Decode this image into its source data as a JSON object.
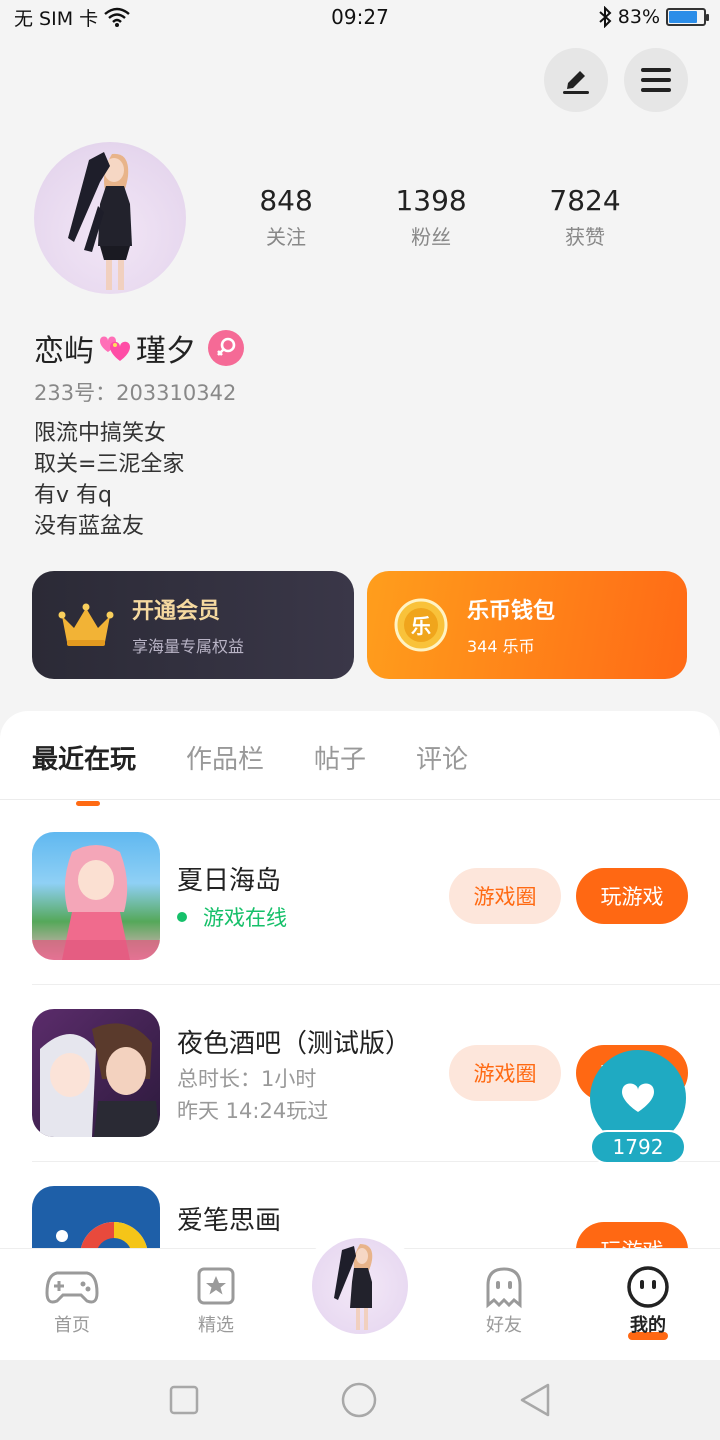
{
  "status_bar": {
    "carrier": "无 SIM 卡",
    "time": "09:27",
    "battery_percent": "83%",
    "battery_level": 0.83
  },
  "profile": {
    "stats": [
      {
        "value": "848",
        "label": "关注"
      },
      {
        "value": "1398",
        "label": "粉丝"
      },
      {
        "value": "7824",
        "label": "获赞"
      }
    ],
    "nickname_part1": "恋屿",
    "nickname_part2": "瑾夕",
    "uid": "233号：203310342",
    "bio": [
      "限流中搞笑女",
      "取关=三泥全家",
      "有v 有q",
      "没有蓝盆友"
    ]
  },
  "cards": {
    "vip_title": "开通会员",
    "vip_sub": "享海量专属权益",
    "wallet_title": "乐币钱包",
    "wallet_sub": "344 乐币",
    "coin_glyph": "乐"
  },
  "tabs": [
    "最近在玩",
    "作品栏",
    "帖子",
    "评论"
  ],
  "games": [
    {
      "title": "夏日海岛",
      "status": "游戏在线",
      "circle_label": "游戏圈",
      "play_label": "玩游戏"
    },
    {
      "title": "夜色酒吧（测试版）",
      "duration": "总时长：1小时",
      "last_played": "昨天 14:24玩过",
      "circle_label": "游戏圈",
      "play_label": "玩游戏"
    },
    {
      "title": "爱笔思画",
      "play_label": "玩游戏"
    }
  ],
  "like_count": "1792",
  "nav": [
    "首页",
    "精选",
    "好友",
    "我的"
  ],
  "colors": {
    "accent": "#ff6813",
    "online": "#16c06a",
    "like": "#1faac2"
  }
}
